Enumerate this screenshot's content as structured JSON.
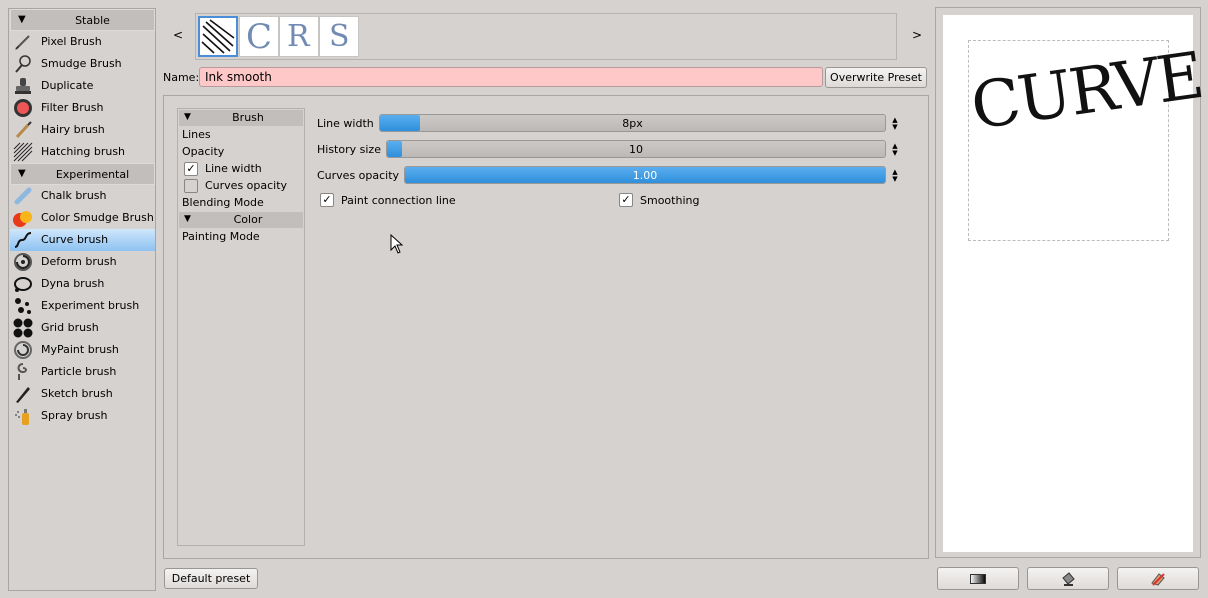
{
  "engine_groups": {
    "stable": "Stable",
    "experimental": "Experimental"
  },
  "engines": {
    "pixel": "Pixel Brush",
    "smudge": "Smudge Brush",
    "duplicate": "Duplicate",
    "filter": "Filter Brush",
    "hairy": "Hairy brush",
    "hatching": "Hatching brush",
    "chalk": "Chalk brush",
    "color_smudge": "Color Smudge Brush",
    "curve": "Curve brush",
    "deform": "Deform brush",
    "dyna": "Dyna brush",
    "experiment": "Experiment brush",
    "grid": "Grid brush",
    "mypaint": "MyPaint brush",
    "particle": "Particle brush",
    "sketch": "Sketch brush",
    "spray": "Spray brush"
  },
  "presets": {
    "prev": "<",
    "next": ">",
    "thumb_letters": [
      "C",
      "R",
      "S"
    ]
  },
  "name_label": "Name:",
  "preset_name": "Ink smooth",
  "overwrite_label": "Overwrite Preset",
  "default_preset_label": "Default preset",
  "options": {
    "brush_group": "Brush",
    "lines": "Lines",
    "opacity": "Opacity",
    "line_width": "Line width",
    "line_width_checked": true,
    "curves_opacity": "Curves opacity",
    "curves_opacity_checked": false,
    "blending_mode": "Blending Mode",
    "color_group": "Color",
    "painting_mode": "Painting Mode"
  },
  "settings": {
    "line_width": {
      "label": "Line width",
      "display": "8px",
      "fraction": 0.08
    },
    "history_size": {
      "label": "History size",
      "display": "10",
      "fraction": 0.03
    },
    "curves_opacity": {
      "label": "Curves opacity",
      "display": "1.00",
      "fraction": 1.0
    },
    "paint_connection_line": {
      "label": "Paint connection line",
      "checked": true
    },
    "smoothing": {
      "label": "Smoothing",
      "checked": true
    }
  },
  "preview_text": "CURVE",
  "icons": {
    "spin": "up-down-arrows",
    "tool1": "gradient-icon",
    "tool2": "fill-bucket-icon",
    "tool3": "eraser-icon"
  },
  "colors": {
    "selected_item": "#8ec2f1",
    "slider_fill": "#3c9be3",
    "name_background": "#ffc8c8"
  }
}
